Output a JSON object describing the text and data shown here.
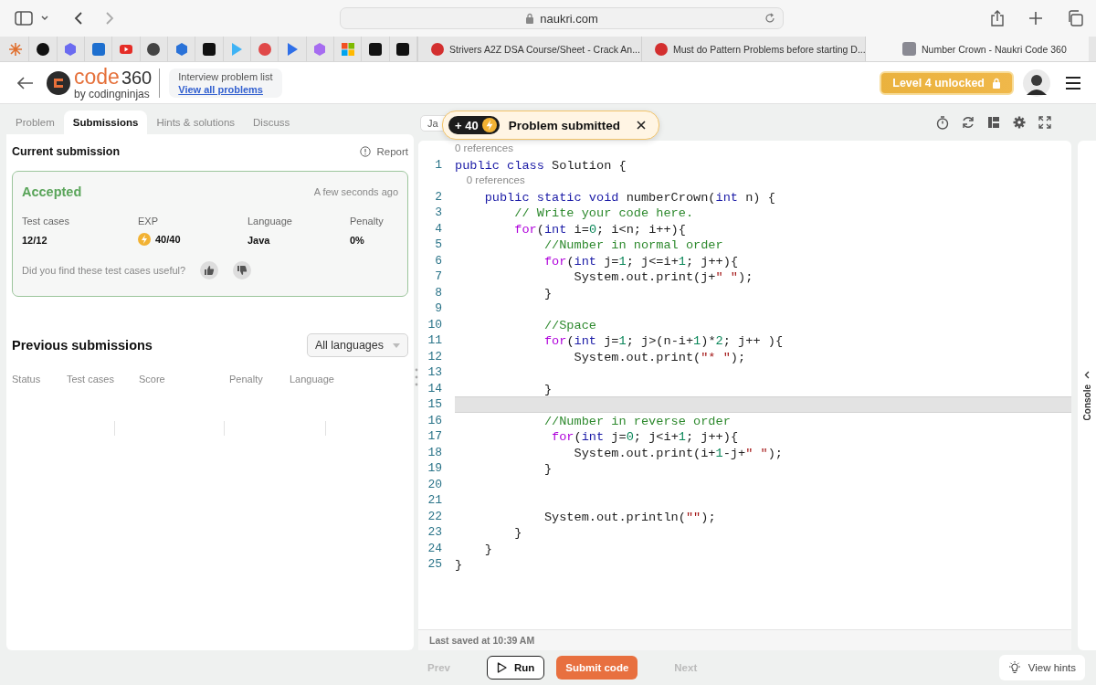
{
  "browser": {
    "address": "naukri.com",
    "tabs": [
      {
        "title": "Strivers A2Z DSA Course/Sheet - Crack An...",
        "selected": false,
        "kind": "badge"
      },
      {
        "title": "Must do Pattern Problems before starting D...",
        "selected": false,
        "kind": "badge"
      },
      {
        "title": "Number Crown - Naukri Code 360",
        "selected": true,
        "kind": "square"
      }
    ]
  },
  "header": {
    "logo": {
      "word": "code",
      "number": "360",
      "tagline": "by codingninjas"
    },
    "breadcrumb": {
      "label": "Interview problem list",
      "link": "View all problems"
    },
    "level_badge": "Level 4 unlocked"
  },
  "left_tabs": [
    {
      "label": "Problem",
      "selected": false
    },
    {
      "label": "Submissions",
      "selected": true
    },
    {
      "label": "Hints & solutions",
      "selected": false
    },
    {
      "label": "Discuss",
      "selected": false
    }
  ],
  "current_submission": {
    "title": "Current submission",
    "report": "Report",
    "status": "Accepted",
    "time": "A few seconds ago",
    "stats": [
      {
        "label": "Test cases",
        "value": "12/12",
        "kind": "plain"
      },
      {
        "label": "EXP",
        "value": "40/40",
        "kind": "exp"
      },
      {
        "label": "Language",
        "value": "Java",
        "kind": "plain"
      },
      {
        "label": "Penalty",
        "value": "0%",
        "kind": "plain"
      }
    ],
    "feedback": "Did you find these test cases useful?"
  },
  "previous_submissions": {
    "title": "Previous submissions",
    "filter": "All languages",
    "columns": [
      "Status",
      "Test cases",
      "Score",
      "Penalty",
      "Language"
    ]
  },
  "editor": {
    "language": "Ja",
    "toast": {
      "points": "+ 40",
      "message": "Problem submitted"
    },
    "lines": [
      {
        "n": "1",
        "references": "0 references",
        "current": false,
        "tokens": [
          {
            "text": "public class",
            "kind": "keyword"
          },
          {
            "text": " Solution {",
            "kind": "plain"
          }
        ]
      },
      {
        "n": "2",
        "references": "0 references",
        "current": false,
        "tokens": [
          {
            "text": "    public static void",
            "kind": "keyword"
          },
          {
            "text": " numberCrown(",
            "kind": "plain"
          },
          {
            "text": "int",
            "kind": "keyword"
          },
          {
            "text": " n) {",
            "kind": "plain"
          }
        ]
      },
      {
        "n": "3",
        "current": false,
        "tokens": [
          {
            "text": "        // Write your code here.",
            "kind": "comment"
          }
        ]
      },
      {
        "n": "4",
        "current": false,
        "tokens": [
          {
            "text": "        for",
            "kind": "control"
          },
          {
            "text": "(",
            "kind": "plain"
          },
          {
            "text": "int",
            "kind": "keyword"
          },
          {
            "text": " i=",
            "kind": "plain"
          },
          {
            "text": "0",
            "kind": "number"
          },
          {
            "text": "; i<n; i++){",
            "kind": "plain"
          }
        ]
      },
      {
        "n": "5",
        "current": false,
        "tokens": [
          {
            "text": "            //Number in normal order",
            "kind": "comment"
          }
        ]
      },
      {
        "n": "6",
        "current": false,
        "tokens": [
          {
            "text": "            for",
            "kind": "control"
          },
          {
            "text": "(",
            "kind": "plain"
          },
          {
            "text": "int",
            "kind": "keyword"
          },
          {
            "text": " j=",
            "kind": "plain"
          },
          {
            "text": "1",
            "kind": "number"
          },
          {
            "text": "; j<=i+",
            "kind": "plain"
          },
          {
            "text": "1",
            "kind": "number"
          },
          {
            "text": "; j++){",
            "kind": "plain"
          }
        ]
      },
      {
        "n": "7",
        "current": false,
        "tokens": [
          {
            "text": "                System.out.print(j+",
            "kind": "plain"
          },
          {
            "text": "\" \"",
            "kind": "string"
          },
          {
            "text": ");",
            "kind": "plain"
          }
        ]
      },
      {
        "n": "8",
        "current": false,
        "tokens": [
          {
            "text": "            }",
            "kind": "plain"
          }
        ]
      },
      {
        "n": "9",
        "current": false
      },
      {
        "n": "10",
        "current": false,
        "tokens": [
          {
            "text": "            //Space",
            "kind": "comment"
          }
        ]
      },
      {
        "n": "11",
        "current": false,
        "tokens": [
          {
            "text": "            for",
            "kind": "control"
          },
          {
            "text": "(",
            "kind": "plain"
          },
          {
            "text": "int",
            "kind": "keyword"
          },
          {
            "text": " j=",
            "kind": "plain"
          },
          {
            "text": "1",
            "kind": "number"
          },
          {
            "text": "; j>(n-i+",
            "kind": "plain"
          },
          {
            "text": "1",
            "kind": "number"
          },
          {
            "text": ")*",
            "kind": "plain"
          },
          {
            "text": "2",
            "kind": "number"
          },
          {
            "text": "; j++ ){",
            "kind": "plain"
          }
        ]
      },
      {
        "n": "12",
        "current": false,
        "tokens": [
          {
            "text": "                System.out.print(",
            "kind": "plain"
          },
          {
            "text": "\"* \"",
            "kind": "string"
          },
          {
            "text": ");",
            "kind": "plain"
          }
        ]
      },
      {
        "n": "13",
        "current": false
      },
      {
        "n": "14",
        "current": false,
        "tokens": [
          {
            "text": "            }",
            "kind": "plain"
          }
        ]
      },
      {
        "n": "15",
        "current": true
      },
      {
        "n": "16",
        "current": false,
        "tokens": [
          {
            "text": "            //Number in reverse order",
            "kind": "comment"
          }
        ]
      },
      {
        "n": "17",
        "current": false,
        "tokens": [
          {
            "text": "             for",
            "kind": "control"
          },
          {
            "text": "(",
            "kind": "plain"
          },
          {
            "text": "int",
            "kind": "keyword"
          },
          {
            "text": " j=",
            "kind": "plain"
          },
          {
            "text": "0",
            "kind": "number"
          },
          {
            "text": "; j<i+",
            "kind": "plain"
          },
          {
            "text": "1",
            "kind": "number"
          },
          {
            "text": "; j++){",
            "kind": "plain"
          }
        ]
      },
      {
        "n": "18",
        "current": false,
        "tokens": [
          {
            "text": "                System.out.print(i+",
            "kind": "plain"
          },
          {
            "text": "1",
            "kind": "number"
          },
          {
            "text": "-j+",
            "kind": "plain"
          },
          {
            "text": "\" \"",
            "kind": "string"
          },
          {
            "text": ");",
            "kind": "plain"
          }
        ]
      },
      {
        "n": "19",
        "current": false,
        "tokens": [
          {
            "text": "            }",
            "kind": "plain"
          }
        ]
      },
      {
        "n": "20",
        "current": false
      },
      {
        "n": "21",
        "current": false
      },
      {
        "n": "22",
        "current": false,
        "tokens": [
          {
            "text": "            System.out.println(",
            "kind": "plain"
          },
          {
            "text": "\"\"",
            "kind": "string"
          },
          {
            "text": ");",
            "kind": "plain"
          }
        ]
      },
      {
        "n": "23",
        "current": false,
        "tokens": [
          {
            "text": "        }",
            "kind": "plain"
          }
        ]
      },
      {
        "n": "24",
        "current": false,
        "tokens": [
          {
            "text": "    }",
            "kind": "plain"
          }
        ]
      },
      {
        "n": "25",
        "current": false,
        "tokens": [
          {
            "text": "}",
            "kind": "plain"
          }
        ]
      }
    ],
    "last_saved": "Last saved at 10:39 AM"
  },
  "console": {
    "label": "Console"
  },
  "footer": {
    "buttons": [
      {
        "label": "Prev",
        "kind": "nav",
        "disabled": true
      },
      {
        "label": "Run",
        "kind": "run",
        "disabled": false
      },
      {
        "label": "Submit code",
        "kind": "submit",
        "disabled": false
      },
      {
        "label": "Next",
        "kind": "nav",
        "disabled": true
      }
    ],
    "hints": "View hints"
  }
}
